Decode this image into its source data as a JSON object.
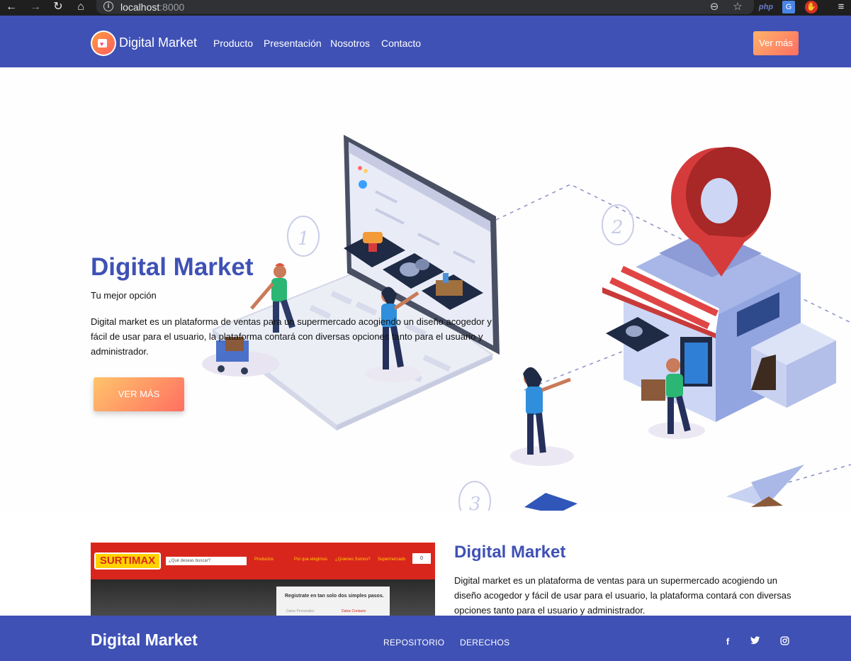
{
  "browser": {
    "url_host": "localhost",
    "url_port": ":8000",
    "info_icon": "info-icon",
    "ext_php": "php"
  },
  "navbar": {
    "brand": "Digital Market",
    "links": [
      "Producto",
      "Presentación",
      "Nosotros",
      "Contacto"
    ],
    "cta": "Ver más"
  },
  "hero": {
    "title": "Digital Market",
    "subtitle": "Tu mejor opción",
    "description": "Digital market es un plataforma de ventas para un supermercado acogiendo un diseño acogedor y fácil de usar para el usuario, la plataforma contará con diversas opciones tanto para el usuario y administrador.",
    "button": "VER MÁS",
    "steps": [
      "1",
      "2",
      "3"
    ]
  },
  "preview": {
    "logo": "SURTIMAX",
    "search_placeholder": "¿Qué deseas buscar?",
    "menu": [
      "Productos",
      "Por que elegirnos",
      "¿Quienes Somos?",
      "Supermercado"
    ],
    "cart_count": "0",
    "panel_title": "Registrate en tan solo dos simples pasos.",
    "panel_step1": "Datos Personales",
    "panel_step2": "Datos Contacto"
  },
  "section": {
    "title": "Digital Market",
    "description": "Digital market es un plataforma de ventas para un supermercado acogiendo un diseño acogedor y fácil de usar para el usuario, la plataforma contará con diversas opciones tanto para el usuario y administrador."
  },
  "footer": {
    "brand": "Digital Market",
    "links": [
      "REPOSITORIO",
      "DERECHOS"
    ],
    "social_icons": [
      "facebook-icon",
      "twitter-icon",
      "instagram-icon"
    ]
  },
  "colors": {
    "primary": "#3f51b5",
    "accent_from": "#ffc46b",
    "accent_to": "#ff6f61"
  }
}
